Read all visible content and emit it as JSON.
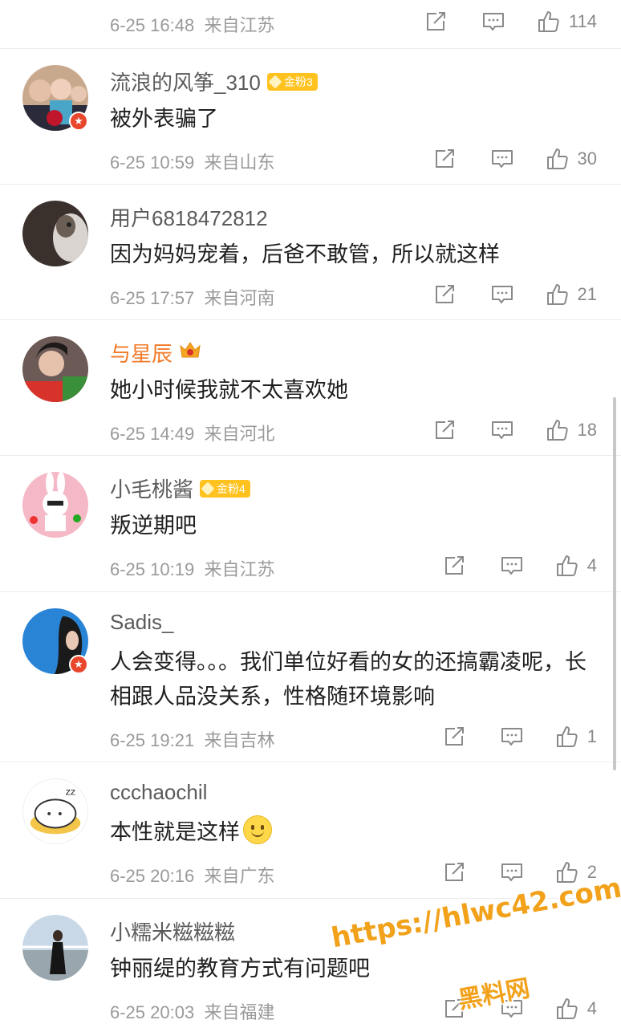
{
  "top_row": {
    "time": "6-25 16:48",
    "source": "来自江苏",
    "likes": "114"
  },
  "comments": [
    {
      "user": "流浪的风筝_310",
      "badge": "金粉3",
      "text": "被外表骗了",
      "time": "6-25 10:59",
      "source": "来自山东",
      "likes": "30"
    },
    {
      "user": "用户6818472812",
      "text": "因为妈妈宠着，后爸不敢管，所以就这样",
      "time": "6-25 17:57",
      "source": "来自河南",
      "likes": "21"
    },
    {
      "user": "与星辰",
      "text": "她小时候我就不太喜欢她",
      "time": "6-25 14:49",
      "source": "来自河北",
      "likes": "18"
    },
    {
      "user": "小毛桃酱",
      "badge": "金粉4",
      "text": "叛逆期吧",
      "time": "6-25 10:19",
      "source": "来自江苏",
      "likes": "4"
    },
    {
      "user": "Sadis_",
      "text": "人会变得。。。我们单位好看的女的还搞霸凌呢，长相跟人品没关系，性格随环境影响",
      "time": "6-25 19:21",
      "source": "来自吉林",
      "likes": "1"
    },
    {
      "user": "ccchaochil",
      "text": "本性就是这样",
      "time": "6-25 20:16",
      "source": "来自广东",
      "likes": "2"
    },
    {
      "user": "小糯米糍糍糍",
      "text": "钟丽缇的教育方式有问题吧",
      "time": "6-25 20:03",
      "source": "来自福建",
      "likes": "4"
    }
  ],
  "watermark": {
    "url": "https://hlwc42.com",
    "name": "黑料网"
  },
  "icons": {
    "share": "share-icon",
    "comment": "comment-icon",
    "like": "thumbs-up-icon"
  },
  "colors": {
    "meta": "#9a9a9a",
    "username": "#5b5b5b",
    "vip_username": "#f27a27",
    "fan_badge": "#ffc21e",
    "watermark": "#f2a11a"
  }
}
